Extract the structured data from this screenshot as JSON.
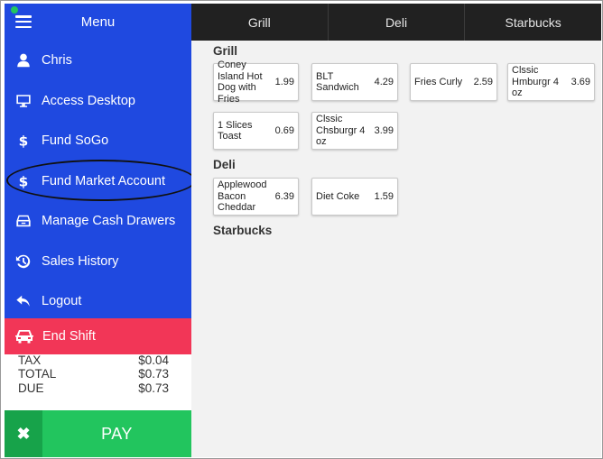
{
  "topbar": {
    "tabs": [
      "Grill",
      "Deli",
      "Starbucks"
    ]
  },
  "menu": {
    "title": "Menu",
    "items": [
      {
        "label": "Chris",
        "icon": "user-icon"
      },
      {
        "label": "Access Desktop",
        "icon": "monitor-icon"
      },
      {
        "label": "Fund SoGo",
        "icon": "dollar-icon"
      },
      {
        "label": "Fund Market Account",
        "icon": "dollar-icon"
      },
      {
        "label": "Manage Cash Drawers",
        "icon": "cash-drawer-icon"
      },
      {
        "label": "Sales History",
        "icon": "history-icon"
      },
      {
        "label": "Logout",
        "icon": "undo-arrow-icon"
      }
    ],
    "end_shift": {
      "label": "End Shift",
      "icon": "car-icon"
    },
    "colors": {
      "menu_bg": "#1f49e0",
      "end_shift_bg": "#f23657",
      "topbar_bg": "#212121",
      "pay_bg": "#22c55e"
    }
  },
  "totals": {
    "tax_label": "TAX",
    "tax_value": "$0.04",
    "total_label": "TOTAL",
    "total_value": "$0.73",
    "due_label": "DUE",
    "due_value": "$0.73"
  },
  "pay": {
    "cancel_label": "✖",
    "pay_label": "PAY"
  },
  "sections": {
    "grill": {
      "title": "Grill",
      "items": [
        {
          "name": "Coney Island Hot Dog with Fries",
          "price": "1.99"
        },
        {
          "name": "BLT Sandwich",
          "price": "4.29"
        },
        {
          "name": "Fries Curly",
          "price": "2.59"
        },
        {
          "name": "Clssic Hmburgr 4 oz",
          "price": "3.69"
        },
        {
          "name": "1 Slices Toast",
          "price": "0.69"
        },
        {
          "name": "Clssic Chsburgr 4 oz",
          "price": "3.99"
        }
      ]
    },
    "deli": {
      "title": "Deli",
      "items": [
        {
          "name": "Applewood Bacon Cheddar",
          "price": "6.39"
        },
        {
          "name": "Diet Coke",
          "price": "1.59"
        }
      ]
    },
    "starbucks": {
      "title": "Starbucks",
      "items": []
    }
  }
}
